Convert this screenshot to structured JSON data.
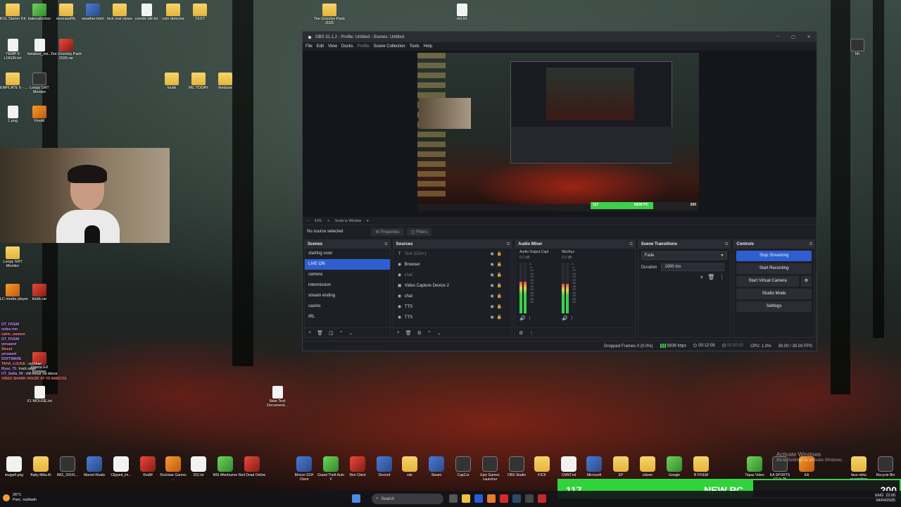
{
  "desktop_icons": [
    {
      "label": "KOL Starter Kit",
      "kind": "folder"
    },
    {
      "label": "balenaEtcher",
      "kind": "green"
    },
    {
      "label": "newnawIRL",
      "kind": "folder"
    },
    {
      "label": "weather.html",
      "kind": "app"
    },
    {
      "label": "kick real views",
      "kind": "folder"
    },
    {
      "label": "cmnds id#.txt",
      "kind": "file"
    },
    {
      "label": "coin detector",
      "kind": "folder"
    },
    {
      "label": "TEST",
      "kind": "folder"
    },
    {
      "label": "Tee Grizzley Pack 2025",
      "kind": "folder"
    },
    {
      "label": "rtsl.txt",
      "kind": "file"
    },
    {
      "label": "TEMP 6 LOGIN.txt",
      "kind": "file"
    },
    {
      "label": "belabox_ins...",
      "kind": "file"
    },
    {
      "label": "Tee Grizzley Pack 2025.rar",
      "kind": "red"
    },
    {
      "label": "hh",
      "kind": "dark"
    },
    {
      "label": "TEMPLATE 6 - ...",
      "kind": "folder"
    },
    {
      "label": "Loopy SRT Monitor",
      "kind": "dark"
    },
    {
      "label": "kickk",
      "kind": "folder"
    },
    {
      "label": "IRL TODAY",
      "kind": "folder"
    },
    {
      "label": "firebase",
      "kind": "folder"
    },
    {
      "label": "1.png",
      "kind": "file"
    },
    {
      "label": "FiveM",
      "kind": "orange"
    },
    {
      "label": "Loopy SRT Monitor",
      "kind": "folder"
    },
    {
      "label": "VLC media player",
      "kind": "orange"
    },
    {
      "label": "kickk.rar",
      "kind": "red"
    },
    {
      "label": "Opera GX Browser",
      "kind": "red"
    },
    {
      "label": "X1 MOUSE.txt",
      "kind": "file"
    },
    {
      "label": "New Text Document...",
      "kind": "file"
    }
  ],
  "chat": [
    {
      "user": "OT_FIVEM",
      "msg": ""
    },
    {
      "user": "nofee-rtm",
      "msg": ""
    },
    {
      "user": "salim_zamane",
      "msg": ""
    },
    {
      "user": "OT_FIVEM",
      "msg": ""
    },
    {
      "user": "yeruawel",
      "msg": ""
    },
    {
      "user": "Skuud",
      "msg": ""
    },
    {
      "user": "yeruawel",
      "msg": ""
    },
    {
      "user": "SOFTWARE",
      "msg": ""
    },
    {
      "user": "TAHA_LOUGE",
      "msg": "sot khari"
    },
    {
      "user": "Illyas_75",
      "msg": "track sabiri"
    },
    {
      "user": "OT_SaNa_99",
      "msg": "chti khbar 3la dansa"
    },
    {
      "user": "VIDEO SHARK HOUZK AT VS NARCOS",
      "msg": ""
    }
  ],
  "obs": {
    "title": "OBS 31.1.2 - Profile: Untitled - Scenes: Untitled",
    "window_buttons": [
      "–",
      "▢",
      "✕"
    ],
    "menu": [
      "File",
      "Edit",
      "View",
      "Docks",
      "Profile",
      "Scene Collection",
      "Tools",
      "Help"
    ],
    "zoom": "41%",
    "scale_mode": "Scale to Window",
    "no_source": "No source selected",
    "properties": "Properties",
    "filters": "Filters",
    "preview_overlay_left": "117",
    "preview_overlay_mid": "NEW PC",
    "preview_overlay_right": "200",
    "preview_overlay_fraction": 0.585,
    "scenes": {
      "title": "Scenes",
      "items": [
        "starting soon",
        "LIVE ON",
        "camera",
        "intermission",
        "stream ending",
        "casino",
        "IRL"
      ],
      "active_index": 1
    },
    "sources": {
      "title": "Sources",
      "items": [
        {
          "label": "Text (GDI+)",
          "icon": "T",
          "dim": true
        },
        {
          "label": "Browser",
          "icon": "◉",
          "dim": false
        },
        {
          "label": "chat",
          "icon": "◉",
          "dim": true
        },
        {
          "label": "Video Capture Device 2",
          "icon": "▣",
          "dim": false
        },
        {
          "label": "chat",
          "icon": "◉",
          "dim": false
        },
        {
          "label": "TTS",
          "icon": "◉",
          "dim": false
        },
        {
          "label": "TTS",
          "icon": "◉",
          "dim": false
        }
      ]
    },
    "mixer": {
      "title": "Audio Mixer",
      "channels": [
        {
          "name": "Audio Output Capt",
          "db": "0.0 dB",
          "level": 0.62
        },
        {
          "name": "Mic/Aux",
          "db": "0.0 dB",
          "level": 0.58
        }
      ],
      "scale": [
        "0",
        "-5",
        "-10",
        "-15",
        "-20",
        "-25",
        "-30",
        "-35",
        "-40",
        "-45",
        "-50",
        "-55",
        "-60"
      ]
    },
    "transitions": {
      "title": "Scene Transitions",
      "type": "Fade",
      "duration_label": "Duration",
      "duration": "1000 ms"
    },
    "controls": {
      "title": "Controls",
      "stop_streaming": "Stop Streaming",
      "start_recording": "Start Recording",
      "start_virtual_camera": "Start Virtual Camera",
      "studio_mode": "Studio Mode",
      "settings": "Settings"
    },
    "status": {
      "dropped": "Dropped Frames 0 (0.0%)",
      "bitrate": "5836 kbps",
      "stream_time": "00:12:08",
      "rec_time": "00:00:00",
      "cpu": "CPU: 1.0%",
      "fps": "30.00 / 30.00 FPS"
    }
  },
  "shortcuts": [
    {
      "label": "image0.png",
      "kind": "file"
    },
    {
      "label": "Baby Mika AI",
      "kind": "folder"
    },
    {
      "label": "IMG_20241...",
      "kind": "dark"
    },
    {
      "label": "Marvel Rivals",
      "kind": "app"
    },
    {
      "label": "Clipped_im...",
      "kind": "file"
    },
    {
      "label": "RedM",
      "kind": "red"
    },
    {
      "label": "Rockstar Games ...",
      "kind": "orange"
    },
    {
      "label": "252.txt",
      "kind": "file"
    },
    {
      "label": "MSI Afterburner",
      "kind": "green"
    },
    {
      "label": "Red Dead Online",
      "kind": "red"
    },
    {
      "label": "Bitvise SSH Client",
      "kind": "app"
    },
    {
      "label": "Grand Theft Auto V",
      "kind": "green"
    },
    {
      "label": "Riot Client",
      "kind": "red"
    },
    {
      "label": "Discord",
      "kind": "app"
    },
    {
      "label": "site",
      "kind": "folder"
    },
    {
      "label": "Steam",
      "kind": "app"
    },
    {
      "label": "CapCut",
      "kind": "dark"
    },
    {
      "label": "Epic Games Launcher",
      "kind": "dark"
    },
    {
      "label": "OBS Studio",
      "kind": "dark"
    },
    {
      "label": "KICK",
      "kind": "folder"
    },
    {
      "label": "CMNT.txt",
      "kind": "file"
    },
    {
      "label": "Microsoft",
      "kind": "app"
    },
    {
      "label": "EP",
      "kind": "folder"
    },
    {
      "label": "citizen",
      "kind": "folder"
    },
    {
      "label": "Google",
      "kind": "green"
    },
    {
      "label": "B FIVEM",
      "kind": "folder"
    },
    {
      "label": "Topaz Video",
      "kind": "green"
    },
    {
      "label": "EA SPORTS FC™ 25",
      "kind": "dark"
    },
    {
      "label": "EA",
      "kind": "orange"
    },
    {
      "label": "face mika recognition",
      "kind": "folder"
    },
    {
      "label": "Recycle Bin",
      "kind": "dark"
    }
  ],
  "activate": {
    "title": "Activate Windows",
    "sub": "Go to Settings to activate Windows."
  },
  "overlay": {
    "left": "117",
    "mid": "NEW PC",
    "right": "200",
    "fraction": 0.57
  },
  "taskbar": {
    "temp": "26°C",
    "weather": "Parc. nublado",
    "search_placeholder": "Search",
    "lang": "ENG",
    "time": "22:00",
    "date": "04/04/2025"
  }
}
